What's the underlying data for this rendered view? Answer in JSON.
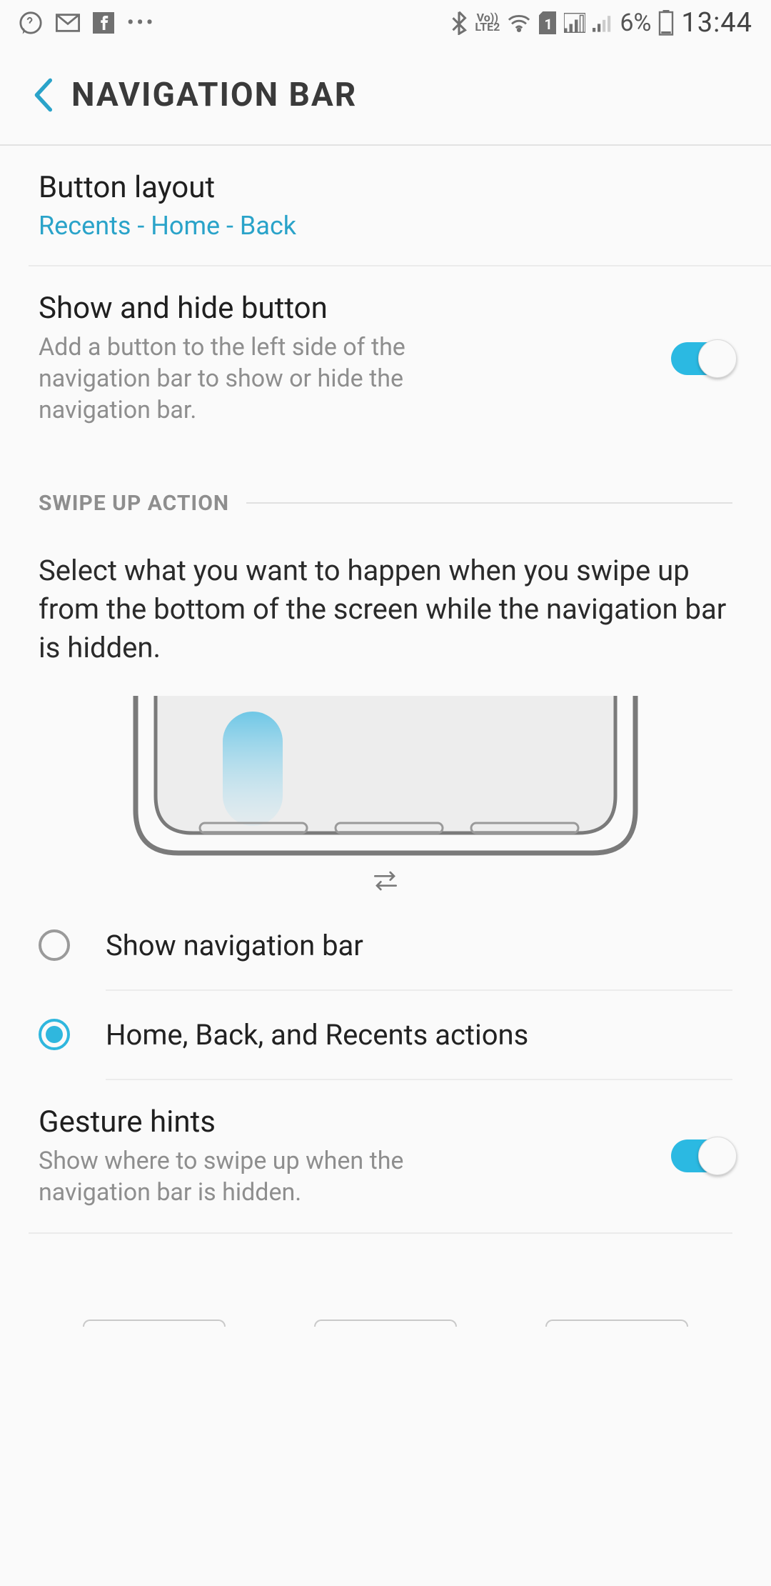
{
  "statusbar": {
    "sim_num": "1",
    "lte_label": "LTE2",
    "vo_label": "Vo))",
    "battery_pct": "6%",
    "time": "13:44"
  },
  "header": {
    "title": "NAVIGATION BAR"
  },
  "button_layout": {
    "title": "Button layout",
    "value": "Recents - Home - Back"
  },
  "show_hide": {
    "title": "Show and hide button",
    "desc": "Add a button to the left side of the navigation bar to show or hide the navigation bar.",
    "enabled": true
  },
  "swipe_section": {
    "heading": "SWIPE UP ACTION",
    "desc": "Select what you want to happen when you swipe up from the bottom of the screen while the navigation bar is hidden."
  },
  "radio_options": [
    {
      "label": "Show navigation bar",
      "selected": false
    },
    {
      "label": "Home, Back, and Recents actions",
      "selected": true
    }
  ],
  "gesture_hints": {
    "title": "Gesture hints",
    "desc": "Show where to swipe up when the navigation bar is hidden.",
    "enabled": true
  }
}
